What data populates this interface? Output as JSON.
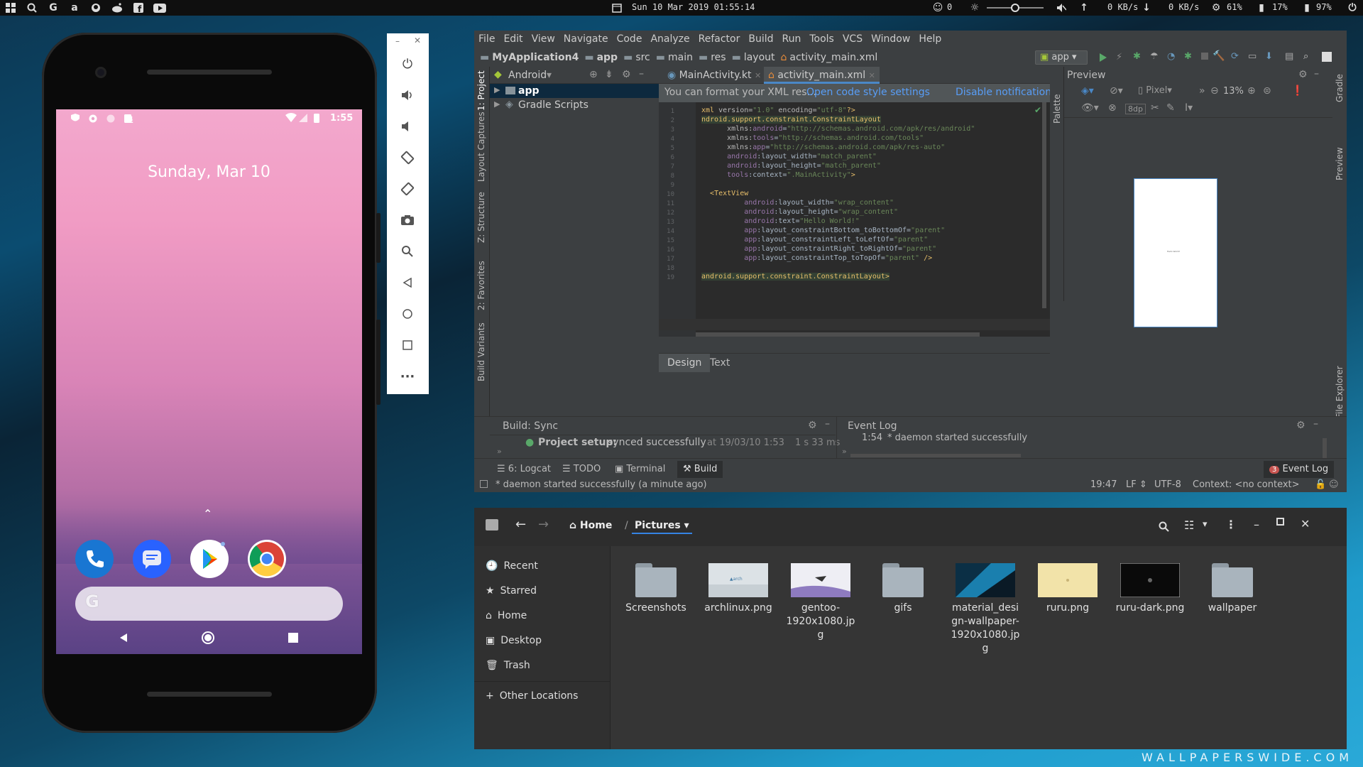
{
  "topbar": {
    "datetime": "Sun 10 Mar 2019 01:55:14",
    "emoji_count": "0",
    "net_up": "0 KB/s",
    "net_down": "0 KB/s",
    "cpu": "61%",
    "mem": "17%",
    "battery": "97%",
    "icons": [
      "windows-icon",
      "search-icon",
      "google-icon",
      "amazon-icon",
      "github-icon",
      "reddit-icon",
      "facebook-icon",
      "youtube-icon"
    ]
  },
  "phone": {
    "time": "1:55",
    "date": "Sunday, Mar 10",
    "search_glyph": "G"
  },
  "ide": {
    "menu": [
      "File",
      "Edit",
      "View",
      "Navigate",
      "Code",
      "Analyze",
      "Refactor",
      "Build",
      "Run",
      "Tools",
      "VCS",
      "Window",
      "Help"
    ],
    "breadcrumb": [
      "MyApplication4",
      "app",
      "src",
      "main",
      "res",
      "layout",
      "activity_main.xml"
    ],
    "run_config": "app",
    "project_view": "Android",
    "tree": [
      "app",
      "Gradle Scripts"
    ],
    "left_tabs": [
      "1: Project",
      "Layout Captures",
      "Z: Structure",
      "2: Favorites",
      "Build Variants"
    ],
    "right_tabs": [
      "Gradle",
      "Preview",
      "Device File Explorer"
    ],
    "palette_tab": "Palette",
    "tabs": [
      "MainActivity.kt",
      "activity_main.xml"
    ],
    "notification": {
      "text": "You can format your XML res...",
      "link1": "Open code style settings",
      "link2": "Disable notification"
    },
    "code_lines": [
      "1",
      "2",
      "3",
      "4",
      "5",
      "6",
      "7",
      "8",
      "9",
      "10",
      "11",
      "12",
      "13",
      "14",
      "15",
      "16",
      "17",
      "18",
      "19"
    ],
    "editor_tabs": [
      "Design",
      "Text"
    ],
    "preview": {
      "title": "Preview",
      "device": "Pixel",
      "zoom": "13%",
      "dp": "8dp",
      "canvas_text": "Hello World!"
    },
    "build": {
      "title": "Build: Sync",
      "result": "Project setup:",
      "result_detail": "synced successfully",
      "timestamp": "at 19/03/10 1:53",
      "duration": "1 s 33 ms"
    },
    "event_log": {
      "title": "Event Log",
      "entry_time": "1:54",
      "entry_text": "* daemon started successfully",
      "badge": "3"
    },
    "bottom_tabs": [
      "6: Logcat",
      "TODO",
      "Terminal",
      "Build"
    ],
    "status": {
      "message": "* daemon started successfully (a minute ago)",
      "position": "19:47",
      "line_sep": "LF",
      "encoding": "UTF-8",
      "context": "Context: <no context>"
    }
  },
  "files": {
    "path_home": "Home",
    "path_current": "Pictures",
    "sidebar": [
      "Recent",
      "Starred",
      "Home",
      "Desktop",
      "Trash",
      "Other Locations"
    ],
    "items": [
      {
        "name": "Screenshots",
        "type": "folder"
      },
      {
        "name": "archlinux.png",
        "type": "image"
      },
      {
        "name": "gentoo-1920x1080.jpg",
        "type": "image"
      },
      {
        "name": "gifs",
        "type": "folder"
      },
      {
        "name": "material_design-wallpaper-1920x1080.jpg",
        "type": "image"
      },
      {
        "name": "ruru.png",
        "type": "image"
      },
      {
        "name": "ruru-dark.png",
        "type": "image"
      },
      {
        "name": "wallpaper",
        "type": "folder"
      }
    ]
  },
  "watermark": "WALLPAPERSWIDE.COM"
}
